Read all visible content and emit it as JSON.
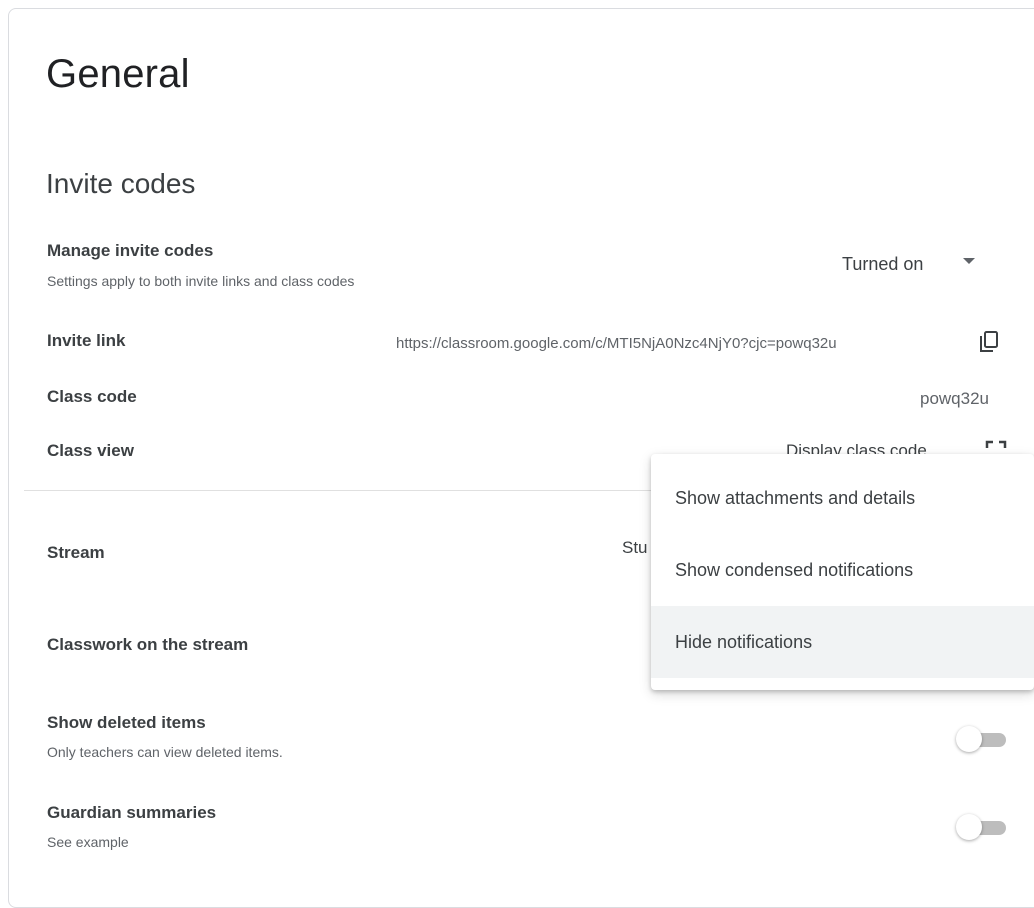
{
  "page": {
    "title": "General"
  },
  "invite_codes": {
    "section_title": "Invite codes",
    "manage": {
      "label": "Manage invite codes",
      "sub": "Settings apply to both invite links and class codes",
      "value": "Turned on"
    },
    "invite_link": {
      "label": "Invite link",
      "value": "https://classroom.google.com/c/MTI5NjA0Nzc4NjY0?cjc=powq32u"
    },
    "class_code": {
      "label": "Class code",
      "value": "powq32u"
    },
    "class_view": {
      "label": "Class view",
      "value": "Display class code"
    }
  },
  "stream": {
    "label": "Stream",
    "value_partial": "Stu"
  },
  "classwork_stream": {
    "label": "Classwork on the stream"
  },
  "show_deleted": {
    "label": "Show deleted items",
    "sub": "Only teachers can view deleted items.",
    "enabled": false
  },
  "guardian_summaries": {
    "label": "Guardian summaries",
    "sub": "See example",
    "enabled": false
  },
  "menu": {
    "items": [
      {
        "label": "Show attachments and details",
        "selected": false
      },
      {
        "label": "Show condensed notifications",
        "selected": false
      },
      {
        "label": "Hide notifications",
        "selected": true
      }
    ]
  },
  "icons": {
    "dropdown": "arrow-drop-down-icon",
    "copy": "copy-icon",
    "fullscreen": "fullscreen-icon"
  }
}
